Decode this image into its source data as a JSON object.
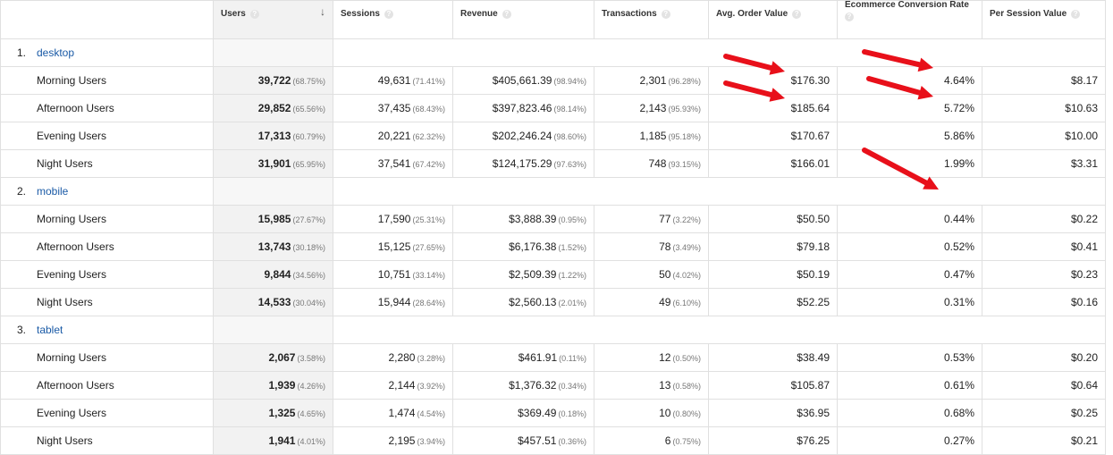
{
  "columns": [
    {
      "label": "",
      "help": false
    },
    {
      "label": "Users",
      "help": true,
      "sort_icon": "down-arrow-icon"
    },
    {
      "label": "Sessions",
      "help": true
    },
    {
      "label": "Revenue",
      "help": true
    },
    {
      "label": "Transactions",
      "help": true
    },
    {
      "label": "Avg. Order Value",
      "help": true
    },
    {
      "label": "Ecommerce Conversion Rate",
      "help": true
    },
    {
      "label": "Per Session Value",
      "help": true
    }
  ],
  "groups": [
    {
      "index": "1.",
      "name": "desktop",
      "rows": [
        {
          "label": "Morning Users",
          "users": "39,722",
          "users_pct": "(68.75%)",
          "sessions": "49,631",
          "sessions_pct": "(71.41%)",
          "revenue": "$405,661.39",
          "revenue_pct": "(98.94%)",
          "transactions": "2,301",
          "transactions_pct": "(96.28%)",
          "aov": "$176.30",
          "conv": "4.64%",
          "psv": "$8.17"
        },
        {
          "label": "Afternoon Users",
          "users": "29,852",
          "users_pct": "(65.56%)",
          "sessions": "37,435",
          "sessions_pct": "(68.43%)",
          "revenue": "$397,823.46",
          "revenue_pct": "(98.14%)",
          "transactions": "2,143",
          "transactions_pct": "(95.93%)",
          "aov": "$185.64",
          "conv": "5.72%",
          "psv": "$10.63"
        },
        {
          "label": "Evening Users",
          "users": "17,313",
          "users_pct": "(60.79%)",
          "sessions": "20,221",
          "sessions_pct": "(62.32%)",
          "revenue": "$202,246.24",
          "revenue_pct": "(98.60%)",
          "transactions": "1,185",
          "transactions_pct": "(95.18%)",
          "aov": "$170.67",
          "conv": "5.86%",
          "psv": "$10.00"
        },
        {
          "label": "Night Users",
          "users": "31,901",
          "users_pct": "(65.95%)",
          "sessions": "37,541",
          "sessions_pct": "(67.42%)",
          "revenue": "$124,175.29",
          "revenue_pct": "(97.63%)",
          "transactions": "748",
          "transactions_pct": "(93.15%)",
          "aov": "$166.01",
          "conv": "1.99%",
          "psv": "$3.31"
        }
      ]
    },
    {
      "index": "2.",
      "name": "mobile",
      "rows": [
        {
          "label": "Morning Users",
          "users": "15,985",
          "users_pct": "(27.67%)",
          "sessions": "17,590",
          "sessions_pct": "(25.31%)",
          "revenue": "$3,888.39",
          "revenue_pct": "(0.95%)",
          "transactions": "77",
          "transactions_pct": "(3.22%)",
          "aov": "$50.50",
          "conv": "0.44%",
          "psv": "$0.22"
        },
        {
          "label": "Afternoon Users",
          "users": "13,743",
          "users_pct": "(30.18%)",
          "sessions": "15,125",
          "sessions_pct": "(27.65%)",
          "revenue": "$6,176.38",
          "revenue_pct": "(1.52%)",
          "transactions": "78",
          "transactions_pct": "(3.49%)",
          "aov": "$79.18",
          "conv": "0.52%",
          "psv": "$0.41"
        },
        {
          "label": "Evening Users",
          "users": "9,844",
          "users_pct": "(34.56%)",
          "sessions": "10,751",
          "sessions_pct": "(33.14%)",
          "revenue": "$2,509.39",
          "revenue_pct": "(1.22%)",
          "transactions": "50",
          "transactions_pct": "(4.02%)",
          "aov": "$50.19",
          "conv": "0.47%",
          "psv": "$0.23"
        },
        {
          "label": "Night Users",
          "users": "14,533",
          "users_pct": "(30.04%)",
          "sessions": "15,944",
          "sessions_pct": "(28.64%)",
          "revenue": "$2,560.13",
          "revenue_pct": "(2.01%)",
          "transactions": "49",
          "transactions_pct": "(6.10%)",
          "aov": "$52.25",
          "conv": "0.31%",
          "psv": "$0.16"
        }
      ]
    },
    {
      "index": "3.",
      "name": "tablet",
      "rows": [
        {
          "label": "Morning Users",
          "users": "2,067",
          "users_pct": "(3.58%)",
          "sessions": "2,280",
          "sessions_pct": "(3.28%)",
          "revenue": "$461.91",
          "revenue_pct": "(0.11%)",
          "transactions": "12",
          "transactions_pct": "(0.50%)",
          "aov": "$38.49",
          "conv": "0.53%",
          "psv": "$0.20"
        },
        {
          "label": "Afternoon Users",
          "users": "1,939",
          "users_pct": "(4.26%)",
          "sessions": "2,144",
          "sessions_pct": "(3.92%)",
          "revenue": "$1,376.32",
          "revenue_pct": "(0.34%)",
          "transactions": "13",
          "transactions_pct": "(0.58%)",
          "aov": "$105.87",
          "conv": "0.61%",
          "psv": "$0.64"
        },
        {
          "label": "Evening Users",
          "users": "1,325",
          "users_pct": "(4.65%)",
          "sessions": "1,474",
          "sessions_pct": "(4.54%)",
          "revenue": "$369.49",
          "revenue_pct": "(0.18%)",
          "transactions": "10",
          "transactions_pct": "(0.80%)",
          "aov": "$36.95",
          "conv": "0.68%",
          "psv": "$0.25"
        },
        {
          "label": "Night Users",
          "users": "1,941",
          "users_pct": "(4.01%)",
          "sessions": "2,195",
          "sessions_pct": "(3.94%)",
          "revenue": "$457.51",
          "revenue_pct": "(0.36%)",
          "transactions": "6",
          "transactions_pct": "(0.75%)",
          "aov": "$76.25",
          "conv": "0.27%",
          "psv": "$0.21"
        }
      ]
    }
  ],
  "annotation_color": "#e8101a"
}
